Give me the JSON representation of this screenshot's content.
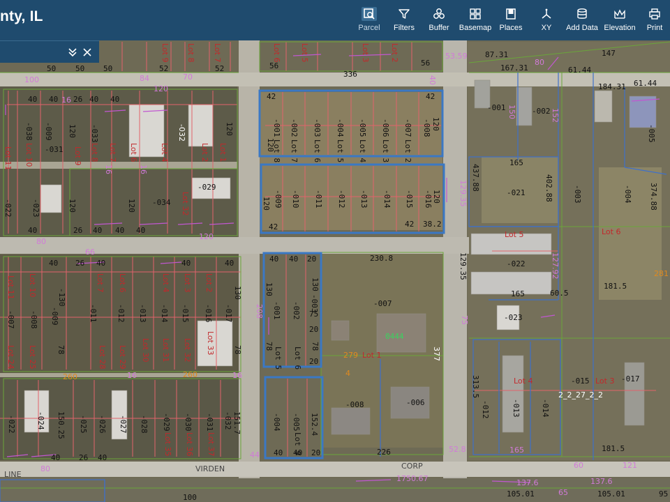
{
  "header": {
    "title": "nty, IL",
    "tools": [
      {
        "id": "parcel",
        "label": "Parcel",
        "icon": "parcel-icon",
        "active": true
      },
      {
        "id": "filters",
        "label": "Filters",
        "icon": "filter-icon",
        "active": false
      },
      {
        "id": "buffer",
        "label": "Buffer",
        "icon": "buffer-icon",
        "active": false
      },
      {
        "id": "basemap",
        "label": "Basemap",
        "icon": "basemap-icon",
        "active": false
      },
      {
        "id": "places",
        "label": "Places",
        "icon": "bookmark-icon",
        "active": false
      },
      {
        "id": "xy",
        "label": "XY",
        "icon": "xy-icon",
        "active": false
      },
      {
        "id": "adddata",
        "label": "Add Data",
        "icon": "database-icon",
        "active": false
      },
      {
        "id": "elevation",
        "label": "Elevation",
        "icon": "elevation-icon",
        "active": false
      },
      {
        "id": "print",
        "label": "Print",
        "icon": "print-icon",
        "active": false
      }
    ]
  },
  "panel": {
    "collapse_icon": "chevron-double-down-icon",
    "close_icon": "close-icon"
  },
  "map": {
    "roads": {
      "virden": "VIRDEN",
      "line": "LINE",
      "corp": "CORP"
    },
    "selected_parcels": {
      "a_nums": [
        "-001",
        "-002",
        "-003",
        "-004",
        "-005",
        "-006",
        "-007",
        "-008"
      ],
      "a_lots": [
        "Lot 8",
        "Lot 7",
        "Lot 6",
        "Lot 5",
        "Lot 4",
        "Lot 3",
        "Lot 2"
      ],
      "a_dims": [
        "42",
        "42",
        "120",
        "120"
      ],
      "b_nums": [
        "-009",
        "-010",
        "-011",
        "-012",
        "-013",
        "-014",
        "-015",
        "-016"
      ],
      "b_dims": [
        "120",
        "120",
        "42",
        "42",
        "38.2"
      ],
      "c_nums": [
        "-001",
        "-002",
        "-003"
      ],
      "c_lots": [
        "Lot 5",
        "Lot 6"
      ],
      "c_dims": [
        "40",
        "40",
        "20",
        "130",
        "130",
        "75",
        "20",
        "78",
        "78",
        "20"
      ],
      "d_nums": [
        "-004",
        "-005"
      ],
      "d_lots": [
        "Lot 9"
      ],
      "d_dims": [
        "152.4",
        "40",
        "40",
        "20"
      ]
    },
    "left_block": {
      "nums": [
        "-038",
        "-009",
        "-031",
        "-033",
        "-034",
        "-029",
        "-022",
        "-023",
        "-032"
      ],
      "lots": [
        "Lot 11",
        "Lot 10",
        "Lot 9",
        "Lot 8",
        "Lot 7",
        "Lot 6",
        "Lot 4",
        "Lot 2",
        "Lot 1",
        "Lot 32"
      ],
      "dims": [
        "26",
        "40",
        "40",
        "40",
        "40",
        "120",
        "120",
        "120",
        "120",
        "26",
        "40",
        "40",
        "40",
        "40",
        "80",
        "120",
        "16",
        "16",
        "16"
      ]
    },
    "mid_block": {
      "nums": [
        "-007",
        "-008",
        "-009",
        "-130",
        "-011",
        "-012",
        "-013",
        "-014",
        "-015",
        "-016",
        "-017"
      ],
      "lots": [
        "Lot 11",
        "Lot 10",
        "Lot 7",
        "Lot 6",
        "Lot 4",
        "Lot 3",
        "Lot 2",
        "Lot 24",
        "Lot 25",
        "Lot 28",
        "Lot 29",
        "Lot 30",
        "Lot 31",
        "Lot 32",
        "Lot 33"
      ],
      "dims": [
        "26",
        "40",
        "40",
        "40",
        "40",
        "66",
        "130",
        "208",
        "78",
        "78",
        "260",
        "260",
        "16",
        "16"
      ]
    },
    "bottom_block": {
      "nums": [
        "-022",
        "-024",
        "-025",
        "-026",
        "-027",
        "-028",
        "-029",
        "-030",
        "-031",
        "-032"
      ],
      "lots": [
        "Lot 35",
        "Lot 36",
        "Lot 37"
      ],
      "dims": [
        "150.25",
        "151.7",
        "26",
        "40",
        "40",
        "40",
        "80",
        "44"
      ]
    },
    "top_strip": {
      "lots": [
        "Lot 9",
        "Lot 8",
        "Lot 7",
        "Lot 6",
        "Lot 5",
        "Lot 3",
        "Lot 2"
      ],
      "dims": [
        "50",
        "50",
        "50",
        "52",
        "52",
        "56",
        "56",
        "100",
        "84",
        "70",
        "336",
        "120",
        "40"
      ]
    },
    "right_block": {
      "nums": [
        "-001",
        "-002",
        "-005",
        "-021",
        "-003",
        "-004",
        "-022",
        "-023",
        "-007",
        "-012",
        "-013",
        "-014",
        "-015",
        "-017",
        "-006",
        "-008"
      ],
      "lots": [
        "Lot 5",
        "Lot 6",
        "Lot 4",
        "Lot 3",
        "Lot 1"
      ],
      "dims": [
        "53.59",
        "87.31",
        "147",
        "167.31",
        "80",
        "61.44",
        "184.31",
        "61.44",
        "165",
        "165",
        "437.88",
        "402.88",
        "374.88",
        "129.35",
        "129.35",
        "127.92",
        "165",
        "60.5",
        "181.5",
        "230.8",
        "75",
        "52.8",
        "313.5",
        "165",
        "181.5",
        "60",
        "121",
        "279",
        "4",
        "226",
        "377",
        "150",
        "152",
        "281",
        "0444",
        "2_2_27_2_2"
      ]
    },
    "bottom_strip": {
      "dims": [
        "1750.67",
        "137.6",
        "137.6",
        "105.01",
        "105.01",
        "95",
        "100",
        "65"
      ]
    }
  },
  "colors": {
    "header_bg": "#1f4b6e",
    "selection_blue": "#3b78c4",
    "parcel_red": "#e0616a",
    "parcel_magenta": "#c157d1",
    "parcel_green": "#6aa23a",
    "road_gray": "#c9c6bd"
  }
}
